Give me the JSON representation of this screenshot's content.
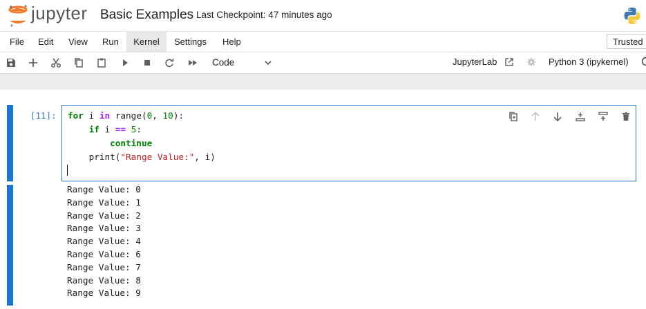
{
  "header": {
    "logo_text": "jupyter",
    "notebook_title": "Basic Examples",
    "checkpoint": "Last Checkpoint: 47 minutes ago"
  },
  "menu": [
    "File",
    "Edit",
    "View",
    "Run",
    "Kernel",
    "Settings",
    "Help"
  ],
  "active_menu": "Kernel",
  "trusted_label": "Trusted",
  "toolbar": {
    "cell_type": "Code",
    "jupyterlab_link": "JupyterLab",
    "kernel_name": "Python 3 (ipykernel)"
  },
  "cell": {
    "prompt": "[11]:",
    "code_lines": [
      "for i in range(0, 10):",
      "    if i == 5:",
      "        continue",
      "    print(\"Range Value:\", i)"
    ],
    "output_lines": [
      "Range Value: 0",
      "Range Value: 1",
      "Range Value: 2",
      "Range Value: 3",
      "Range Value: 4",
      "Range Value: 6",
      "Range Value: 7",
      "Range Value: 8",
      "Range Value: 9"
    ]
  },
  "colors": {
    "accent": "#1976d2",
    "prompt": "#307fc1",
    "jupyter_orange": "#f37726",
    "keyword": "#008000",
    "string": "#ba2121",
    "operator": "#aa22ff"
  },
  "icons": {
    "toolbar": [
      "save-icon",
      "add-cell-icon",
      "cut-icon",
      "copy-icon",
      "paste-icon",
      "run-icon",
      "stop-icon",
      "restart-icon",
      "fast-forward-icon"
    ],
    "cell_tools": [
      "duplicate-icon",
      "move-up-icon",
      "move-down-icon",
      "insert-above-icon",
      "insert-below-icon",
      "delete-icon"
    ]
  }
}
